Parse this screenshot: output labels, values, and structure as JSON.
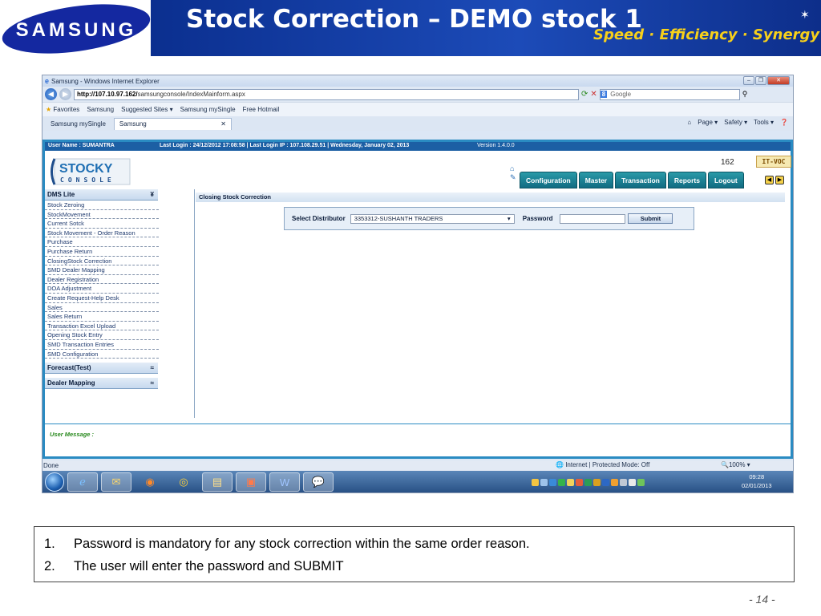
{
  "slide": {
    "title": "Stock Correction – DEMO stock 1",
    "slogan": "Speed · Efficiency · Synergy",
    "logo_text": "SAMSUNG",
    "page_number": "-  14  -"
  },
  "browser": {
    "window_title": "Samsung - Windows Internet Explorer",
    "url_host": "http://107.10.97.162/",
    "url_path": "samsungconsole/IndexMainform.aspx",
    "search_placeholder": "Google",
    "search_badge": "8",
    "favorites_label": "Favorites",
    "favorites": [
      "Samsung",
      "Suggested Sites ▾",
      "Samsung mySingle",
      "Free Hotmail"
    ],
    "tabs": [
      "Samsung mySingle",
      "Samsung"
    ],
    "commands": [
      "Page ▾",
      "Safety ▾",
      "Tools ▾"
    ],
    "status_text": "Done",
    "status_zone": "Internet | Protected Mode: Off",
    "status_zoom": "100%"
  },
  "app": {
    "user_info": "User Name : SUMANTRA",
    "last_login": "Last Login : 24/12/2012 17:08:58 | Last Login IP : 107.108.29.51 | Wednesday, January 02, 2013",
    "version": "Version 1.4.0.0",
    "logo_word": "STOCKY",
    "logo_sub": "CONSOLE",
    "counter": "162",
    "badge": "IT-VOC",
    "nav": [
      "Configuration",
      "Master",
      "Transaction",
      "Reports",
      "Logout"
    ],
    "menu_sections": [
      {
        "title": "DMS Lite",
        "expander": "¥",
        "items": [
          "Stock Zeroing",
          "StockMovement",
          "Current Sotck",
          "Stock Movement - Order Reason",
          "Purchase",
          "Purchase Return",
          "ClosingStock Correction",
          "SMD Dealer Mapping",
          "Dealer Registration",
          "DOA Adjustment",
          "Create Request-Help Desk",
          "Sales",
          "Sales Return",
          "Transaction Excel Upload",
          "Opening Stock Entry",
          "SMD Transaction Entries",
          "SMD Configuration"
        ]
      },
      {
        "title": "Forecast(Test)",
        "expander": "≈",
        "items": []
      },
      {
        "title": "Dealer Mapping",
        "expander": "≈",
        "items": []
      }
    ],
    "content_title": "Closing Stock Correction",
    "form": {
      "distributor_label": "Select Distributor",
      "distributor_value": "3353312-SUSHANTH TRADERS",
      "password_label": "Password",
      "password_value": "",
      "submit_label": "Submit"
    },
    "user_message_label": "User Message :"
  },
  "taskbar": {
    "clock_time": "09:28",
    "clock_date": "02/01/2013"
  },
  "notes": [
    {
      "num": "1.",
      "text": "Password is mandatory for any stock correction within the same order reason."
    },
    {
      "num": "2.",
      "text": "The user will enter the password and SUBMIT"
    }
  ]
}
